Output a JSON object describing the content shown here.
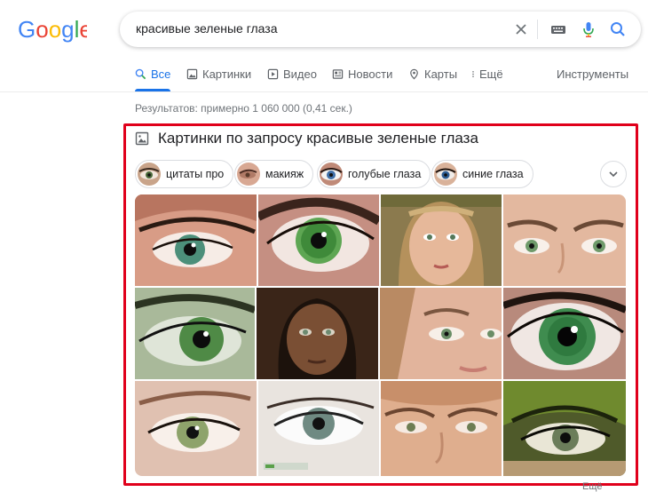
{
  "logo": {
    "text": "Google",
    "icon": "google-logo"
  },
  "search": {
    "query": "красивые зеленые глаза",
    "icons": [
      "clear-icon",
      "keyboard-icon",
      "mic-icon",
      "search-icon"
    ]
  },
  "tabs": [
    {
      "label": "Все",
      "icon": "search-icon",
      "active": true
    },
    {
      "label": "Картинки",
      "icon": "image-icon"
    },
    {
      "label": "Видео",
      "icon": "video-icon"
    },
    {
      "label": "Новости",
      "icon": "news-icon"
    },
    {
      "label": "Карты",
      "icon": "map-pin-icon"
    },
    {
      "label": "Ещё",
      "icon": "more-vert-icon"
    }
  ],
  "tools_label": "Инструменты",
  "results_count": "Результатов: примерно 1 060 000 (0,41 сек.)",
  "images_block": {
    "title": "Картинки по запросу красивые зеленые глаза",
    "chips": [
      "цитаты про",
      "макияж",
      "голубые глаза",
      "синие глаза"
    ],
    "more_label": "Ещё"
  },
  "colors": {
    "accent": "#1a73e8",
    "frame": "#e0001b"
  }
}
